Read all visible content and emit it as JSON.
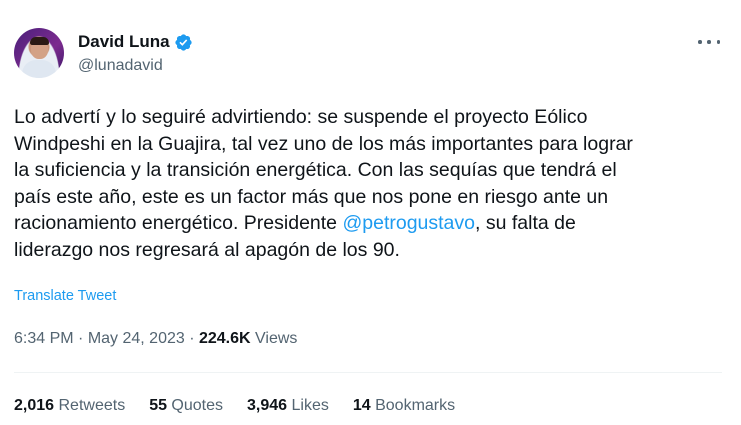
{
  "author": {
    "name": "David Luna",
    "handle": "@lunadavid",
    "verified": true
  },
  "tweet": {
    "text_before": "Lo advertí y lo seguiré advirtiendo: se suspende el proyecto Eólico\nWindpeshi en la Guajira, tal vez uno de los más importantes para lograr\nla suficiencia y la transición energética. Con las sequías que tendrá el\npaís este año, este es un factor más que nos pone en riesgo ante un\nracionamiento energético. Presidente ",
    "mention": "@petrogustavo",
    "text_after": ", su falta de\nliderazgo nos regresará al apagón de los 90.",
    "translate_label": "Translate Tweet"
  },
  "meta": {
    "time": "6:34 PM",
    "separator1": " · ",
    "date": "May 24, 2023",
    "separator2": " · ",
    "views_count": "224.6K",
    "views_label": " Views"
  },
  "stats": {
    "retweets_count": "2,016",
    "retweets_label": " Retweets",
    "quotes_count": "55",
    "quotes_label": " Quotes",
    "likes_count": "3,946",
    "likes_label": " Likes",
    "bookmarks_count": "14",
    "bookmarks_label": " Bookmarks"
  },
  "colors": {
    "accent": "#1d9bf0",
    "text": "#0f1419",
    "secondary": "#536471"
  },
  "icons": {
    "verified": "verified-badge-icon",
    "more": "more-options-icon"
  }
}
